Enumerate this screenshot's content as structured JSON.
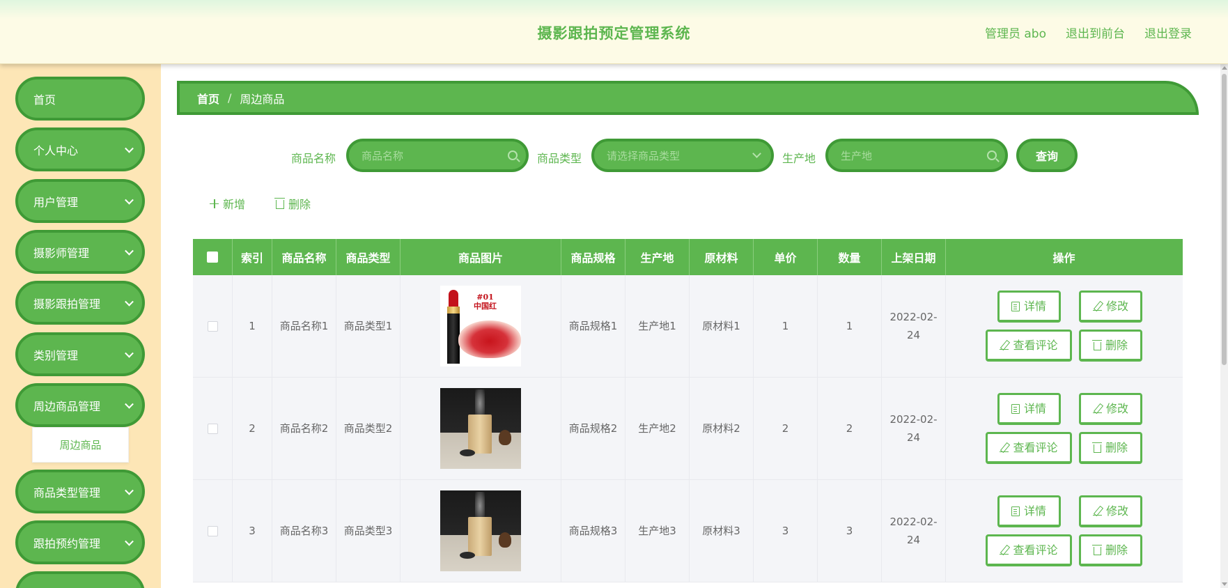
{
  "header": {
    "title": "摄影跟拍预定管理系统",
    "user": "管理员 abo",
    "to_frontend": "退出到前台",
    "logout": "退出登录"
  },
  "sidebar": {
    "items": [
      {
        "label": "首页",
        "has_children": false
      },
      {
        "label": "个人中心",
        "has_children": true
      },
      {
        "label": "用户管理",
        "has_children": true
      },
      {
        "label": "摄影师管理",
        "has_children": true
      },
      {
        "label": "摄影跟拍管理",
        "has_children": true
      },
      {
        "label": "类别管理",
        "has_children": true
      },
      {
        "label": "周边商品管理",
        "has_children": true
      },
      {
        "label": "商品类型管理",
        "has_children": true
      },
      {
        "label": "跟拍预约管理",
        "has_children": true
      }
    ],
    "active_sub": "周边商品"
  },
  "breadcrumb": {
    "home": "首页",
    "sep": "/",
    "current": "周边商品"
  },
  "search": {
    "name_label": "商品名称",
    "name_placeholder": "商品名称",
    "type_label": "商品类型",
    "type_placeholder": "请选择商品类型",
    "origin_label": "生产地",
    "origin_placeholder": "生产地",
    "query_button": "查询"
  },
  "actions": {
    "add": "新增",
    "delete": "删除"
  },
  "table": {
    "headers": [
      "",
      "索引",
      "商品名称",
      "商品类型",
      "商品图片",
      "商品规格",
      "生产地",
      "原材料",
      "单价",
      "数量",
      "上架日期",
      "操作"
    ],
    "rows": [
      {
        "index": "1",
        "name": "商品名称1",
        "type": "商品类型1",
        "image": "lipstick",
        "spec": "商品规格1",
        "origin": "生产地1",
        "material": "原材料1",
        "price": "1",
        "qty": "1",
        "date": "2022-02-24"
      },
      {
        "index": "2",
        "name": "商品名称2",
        "type": "商品类型2",
        "image": "incense",
        "spec": "商品规格2",
        "origin": "生产地2",
        "material": "原材料2",
        "price": "2",
        "qty": "2",
        "date": "2022-02-24"
      },
      {
        "index": "3",
        "name": "商品名称3",
        "type": "商品类型3",
        "image": "incense",
        "spec": "商品规格3",
        "origin": "生产地3",
        "material": "原材料3",
        "price": "3",
        "qty": "3",
        "date": "2022-02-24"
      }
    ],
    "ops": {
      "detail": "详情",
      "edit": "修改",
      "comments": "查看评论",
      "delete": "删除"
    }
  },
  "product_image_text": {
    "tag": "#01",
    "title": "中国红"
  },
  "colors": {
    "accent": "#5db64f",
    "accent_dark": "#3f9a36",
    "sidebar_bg": "#fde6b6",
    "header_bg": "#fdfbe6"
  }
}
